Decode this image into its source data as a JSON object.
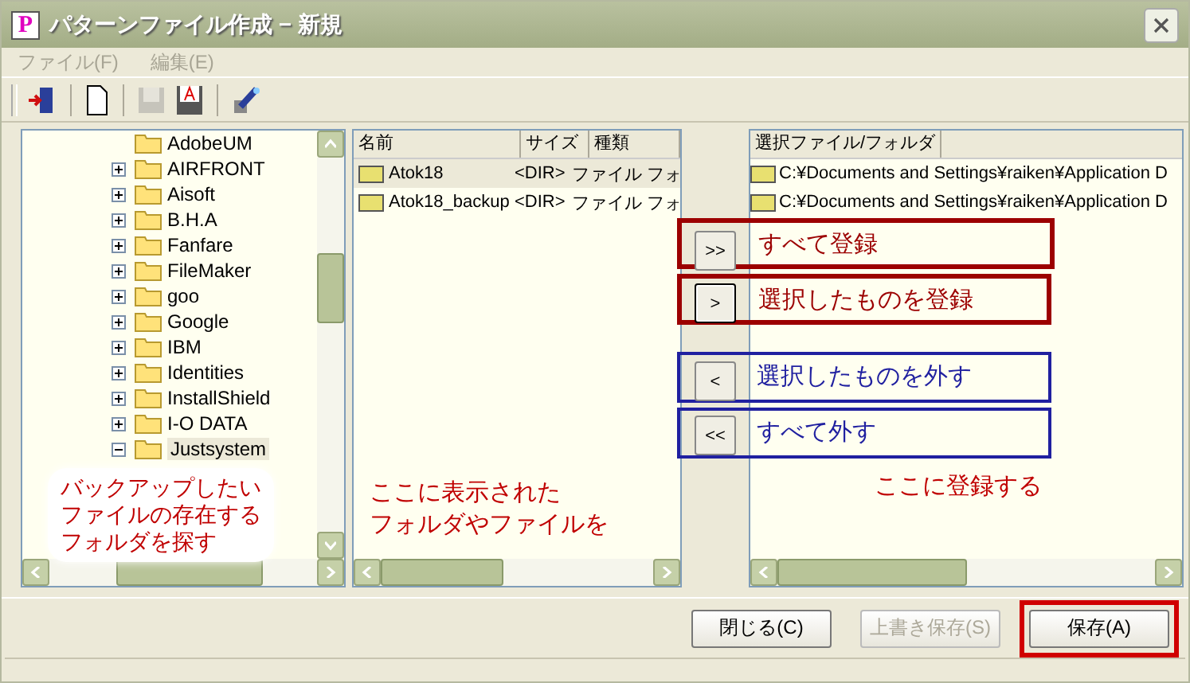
{
  "window": {
    "logo": "P",
    "title": "パターンファイル作成 − 新規"
  },
  "menu": [
    {
      "label": "ファイル(F)",
      "disabled": true
    },
    {
      "label": "編集(E)",
      "disabled": true
    }
  ],
  "toolbar": [
    {
      "kind": "exit",
      "disabled": false
    },
    {
      "kind": "new",
      "disabled": false
    },
    {
      "kind": "save",
      "disabled": true
    },
    {
      "kind": "saveas",
      "disabled": false
    },
    {
      "kind": "wizard",
      "disabled": false
    }
  ],
  "tree": {
    "items": [
      {
        "label": "AdobeUM",
        "has_children": false,
        "selected": false
      },
      {
        "label": "AIRFRONT",
        "has_children": true,
        "expanded": false,
        "selected": false
      },
      {
        "label": "Aisoft",
        "has_children": true,
        "expanded": false,
        "selected": false
      },
      {
        "label": "B.H.A",
        "has_children": true,
        "expanded": false,
        "selected": false
      },
      {
        "label": "Fanfare",
        "has_children": true,
        "expanded": false,
        "selected": false
      },
      {
        "label": "FileMaker",
        "has_children": true,
        "expanded": false,
        "selected": false
      },
      {
        "label": "goo",
        "has_children": true,
        "expanded": false,
        "selected": false
      },
      {
        "label": "Google",
        "has_children": true,
        "expanded": false,
        "selected": false
      },
      {
        "label": "IBM",
        "has_children": true,
        "expanded": false,
        "selected": false
      },
      {
        "label": "Identities",
        "has_children": true,
        "expanded": false,
        "selected": false
      },
      {
        "label": "InstallShield",
        "has_children": true,
        "expanded": false,
        "selected": false
      },
      {
        "label": "I-O DATA",
        "has_children": true,
        "expanded": false,
        "selected": false
      },
      {
        "label": "Justsystem",
        "has_children": true,
        "expanded": true,
        "selected": true
      }
    ],
    "note": [
      "バックアップしたい",
      "ファイルの存在する",
      "フォルダを探す"
    ]
  },
  "file_list": {
    "columns": [
      "名前",
      "サイズ",
      "種類"
    ],
    "rows": [
      {
        "cells": [
          "Atok18",
          "<DIR>",
          "ファイル フォ"
        ],
        "selected": true
      },
      {
        "cells": [
          "Atok18_backup",
          "<DIR>",
          "ファイル フォ"
        ],
        "selected": false
      }
    ],
    "note": [
      "ここに表示された",
      "フォルダやファイルを"
    ]
  },
  "transfer_buttons": [
    {
      "label": ">>",
      "focused": false,
      "callout": "すべて登録",
      "color": "#9c0000"
    },
    {
      "label": ">",
      "focused": true,
      "callout": "選択したものを登録",
      "color": "#9c0000"
    },
    {
      "label": "<",
      "focused": false,
      "callout": "選択したものを外す",
      "color": "#2020a0"
    },
    {
      "label": "<<",
      "focused": false,
      "callout": "すべて外す",
      "color": "#2020a0"
    }
  ],
  "selected_list": {
    "column": "選択ファイル/フォルダ",
    "rows": [
      "C:¥Documents and Settings¥raiken¥Application D",
      "C:¥Documents and Settings¥raiken¥Application D"
    ],
    "note": "ここに登録する"
  },
  "buttons": [
    {
      "label": "閉じる(C)",
      "disabled": false,
      "highlighted": false
    },
    {
      "label": "上書き保存(S)",
      "disabled": true,
      "highlighted": false
    },
    {
      "label": "保存(A)",
      "disabled": false,
      "highlighted": true
    }
  ]
}
